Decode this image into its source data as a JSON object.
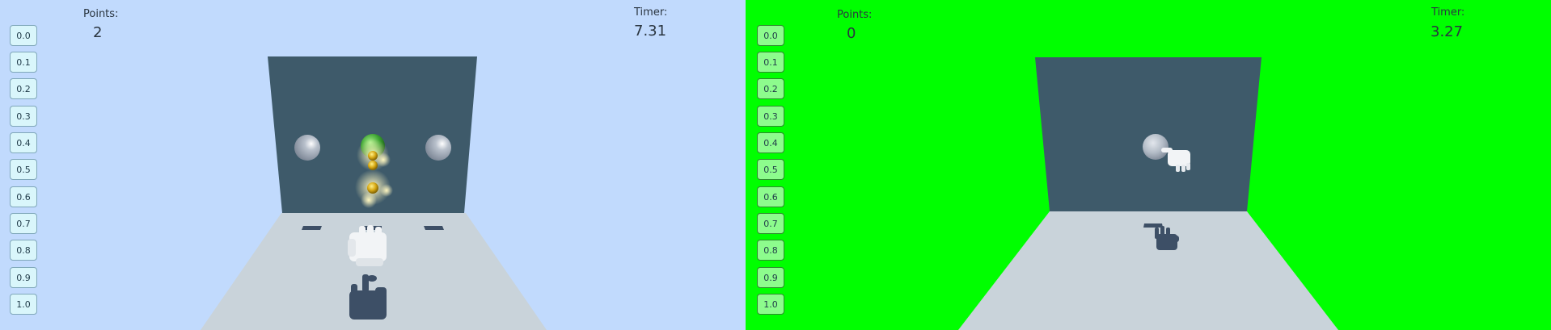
{
  "levels": [
    "0.0",
    "0.1",
    "0.2",
    "0.3",
    "0.4",
    "0.5",
    "0.6",
    "0.7",
    "0.8",
    "0.9",
    "1.0"
  ],
  "left_view": {
    "points_label": "Points:",
    "points_value": "2",
    "timer_label": "Timer:",
    "timer_value": "7.31",
    "background_color": "#c1dafd"
  },
  "right_view": {
    "points_label": "Points:",
    "points_value": "0",
    "timer_label": "Timer:",
    "timer_value": "3.27",
    "background_color": "#00ff00"
  },
  "colors": {
    "wall": "#3e5a6a",
    "floor": "#c9d3da",
    "target_ball": "#3aa12f",
    "coin": "#e0b820",
    "hand": "#3d4f66"
  }
}
